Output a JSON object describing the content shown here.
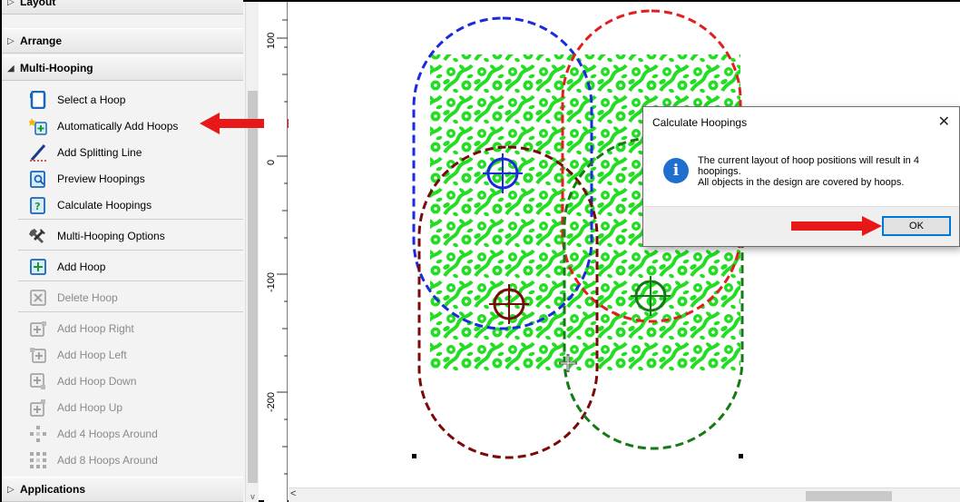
{
  "panel": {
    "sections": {
      "layout": "Layout",
      "arrange": "Arrange",
      "multi_hooping": "Multi-Hooping",
      "applications": "Applications"
    },
    "items": [
      {
        "label": "Select a Hoop",
        "icon": "hoop-select-icon",
        "enabled": true
      },
      {
        "label": "Automatically Add Hoops",
        "icon": "auto-add-hoops-icon",
        "enabled": true
      },
      {
        "label": "Add Splitting Line",
        "icon": "splitting-line-icon",
        "enabled": true
      },
      {
        "label": "Preview Hoopings",
        "icon": "preview-hoopings-icon",
        "enabled": true
      },
      {
        "label": "Calculate Hoopings",
        "icon": "calculate-hoopings-icon",
        "enabled": true
      },
      {
        "label": "Multi-Hooping Options",
        "icon": "tools-icon",
        "enabled": true
      },
      {
        "label": "Add Hoop",
        "icon": "add-hoop-icon",
        "enabled": true
      },
      {
        "label": "Delete Hoop",
        "icon": "delete-hoop-icon",
        "enabled": false
      },
      {
        "label": "Add Hoop Right",
        "icon": "add-hoop-right-icon",
        "enabled": false
      },
      {
        "label": "Add Hoop Left",
        "icon": "add-hoop-left-icon",
        "enabled": false
      },
      {
        "label": "Add Hoop Down",
        "icon": "add-hoop-down-icon",
        "enabled": false
      },
      {
        "label": "Add Hoop Up",
        "icon": "add-hoop-up-icon",
        "enabled": false
      },
      {
        "label": "Add 4 Hoops Around",
        "icon": "add-4-hoops-icon",
        "enabled": false
      },
      {
        "label": "Add 8 Hoops Around",
        "icon": "add-8-hoops-icon",
        "enabled": false
      }
    ]
  },
  "ruler": {
    "labels": [
      "100",
      "0",
      "-100",
      "-200"
    ]
  },
  "dialog": {
    "title": "Calculate Hoopings",
    "close": "✕",
    "icon_glyph": "i",
    "message_line1": "The current layout of hoop positions will result in 4",
    "message_line2": "hoopings.",
    "message_line3": "All objects in the design are covered by hoops.",
    "ok_label": "OK"
  },
  "scroll": {
    "left_arrow": "<",
    "down_arrow": "v"
  },
  "colors": {
    "accent_red": "#e81818",
    "pattern_green": "#22dd22",
    "hoop_blue": "#1a2adc",
    "hoop_red": "#e02020",
    "hoop_darkred": "#7a0a0a",
    "hoop_darkgreen": "#147a14",
    "info_blue": "#1f6fcf"
  }
}
